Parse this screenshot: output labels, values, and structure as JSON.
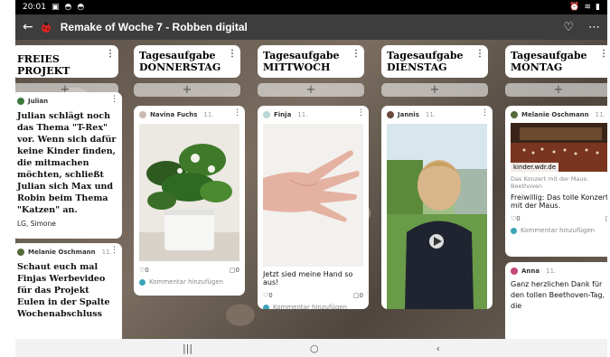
{
  "status": {
    "time": "20:01"
  },
  "app": {
    "title": "Remake of Woche 7 - Robben digital"
  },
  "columns": {
    "c1": {
      "title": "FREIES PROJEKT"
    },
    "c2": {
      "title1": "Tagesaufgabe",
      "title2": "DONNERSTAG"
    },
    "c3": {
      "title1": "Tagesaufgabe",
      "title2": "MITTWOCH"
    },
    "c4": {
      "title1": "Tagesaufgabe",
      "title2": "DIENSTAG"
    },
    "c5": {
      "title1": "Tagesaufgabe",
      "title2": "MONTAG"
    }
  },
  "add_symbol": "+",
  "comment_placeholder": "Kommentar hinzufügen",
  "posts": {
    "julian": {
      "author": "Julian",
      "ago": "11.",
      "text": "Julian schlägt noch das Thema \"T-Rex\" vor. Wenn sich dafür keine Kinder finden, die mitmachen möchten, schließt Julian sich Max und Robin beim Thema \"Katzen\" an.",
      "sign": "LG, Simone",
      "likes": "0",
      "comments": "0"
    },
    "melanie1": {
      "author": "Melanie Oschmann",
      "ago": "11.",
      "text": "Schaut euch mal Finjas Werbevideo für das Projekt Eulen in der Spalte Wochenabschluss"
    },
    "navina": {
      "author": "Navina Fuchs",
      "ago": "11.",
      "likes": "0",
      "comments": "0"
    },
    "finja": {
      "author": "Finja",
      "ago": "11.",
      "caption": "Jetzt sied meine Hand so aus!",
      "likes": "0",
      "comments": "0"
    },
    "jannis": {
      "author": "Jannis",
      "ago": "11."
    },
    "melanie2": {
      "author": "Melanie Oschmann",
      "ago": "11.",
      "source": "kinder.wdr.de",
      "link_title": "Das Konzert mit der Maus: Beethoven",
      "text": "Freiwillig: Das tolle Konzert mit der Maus.",
      "likes": "0",
      "comments": "0"
    },
    "anna": {
      "author": "Anna",
      "ago": "11.",
      "text": "Ganz herzlichen Dank für den tollen Beethoven-Tag, die"
    }
  },
  "colors": {
    "appbar": "#3d3d3d",
    "accent_avatar": "#3aa3b8"
  }
}
